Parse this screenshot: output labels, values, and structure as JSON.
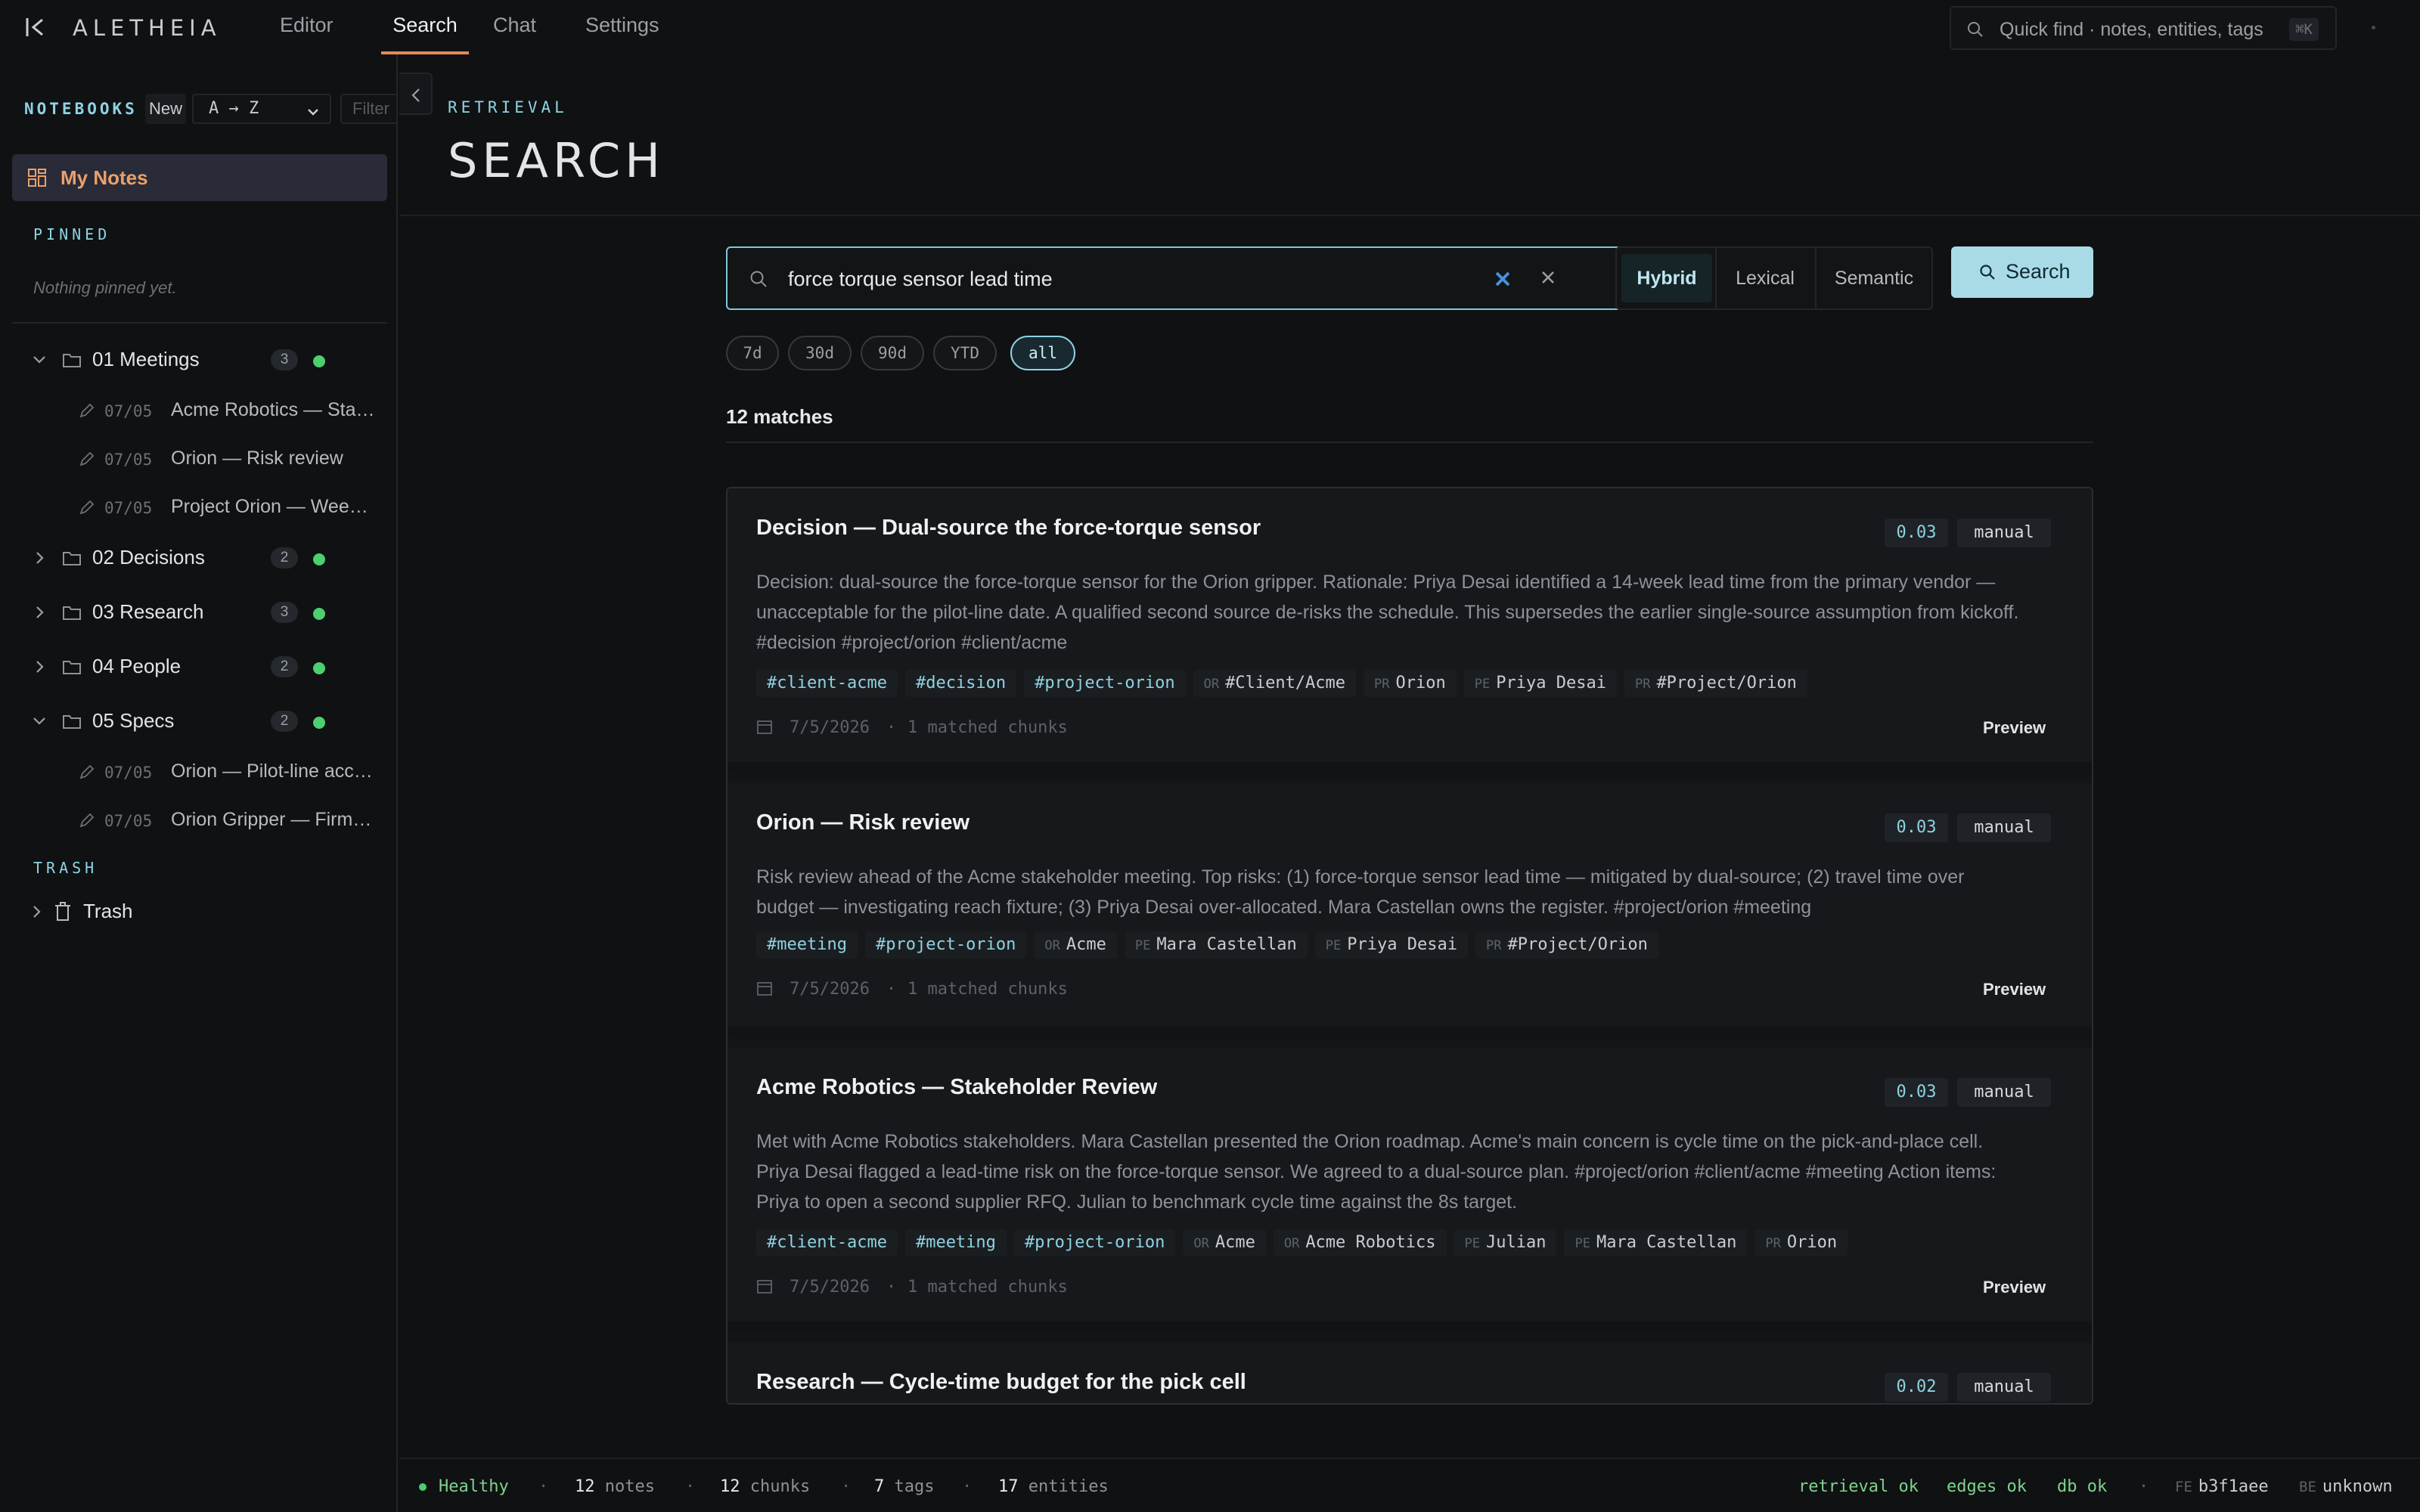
{
  "app": {
    "brand": "ALETHEIA",
    "tabs": [
      {
        "label": "Editor"
      },
      {
        "label": "Search"
      },
      {
        "label": "Chat"
      },
      {
        "label": "Settings"
      }
    ],
    "active_tab": "Search",
    "quick_find": {
      "placeholder": "Quick find · notes, entities, tags",
      "shortcut": "⌘K"
    }
  },
  "sidebar": {
    "title": "NOTEBOOKS",
    "new_label": "New",
    "sort_value": "A → Z",
    "filter_placeholder": "Filter",
    "my_notes": "My Notes",
    "pinned_label": "PINNED",
    "pinned_empty": "Nothing pinned yet.",
    "folders": [
      {
        "name": "01 Meetings",
        "count": "3",
        "expanded": true,
        "notes": [
          {
            "date": "07/05",
            "title": "Acme Robotics — Stakeholder Review"
          },
          {
            "date": "07/05",
            "title": "Orion — Risk review"
          },
          {
            "date": "07/05",
            "title": "Project Orion — Weekly sync"
          }
        ]
      },
      {
        "name": "02 Decisions",
        "count": "2",
        "expanded": false,
        "notes": []
      },
      {
        "name": "03 Research",
        "count": "3",
        "expanded": false,
        "notes": []
      },
      {
        "name": "04 People",
        "count": "2",
        "expanded": false,
        "notes": []
      },
      {
        "name": "05 Specs",
        "count": "2",
        "expanded": true,
        "notes": [
          {
            "date": "07/05",
            "title": "Orion — Pilot-line acceptance"
          },
          {
            "date": "07/05",
            "title": "Orion Gripper — Firmware spec"
          }
        ]
      }
    ],
    "trash_label": "TRASH",
    "trash_item": "Trash"
  },
  "main": {
    "eyebrow": "RETRIEVAL",
    "title": "SEARCH",
    "query": "force torque sensor lead time",
    "modes": [
      "Hybrid",
      "Lexical",
      "Semantic"
    ],
    "active_mode": "Hybrid",
    "search_button": "Search",
    "ranges": [
      "7d",
      "30d",
      "90d",
      "YTD",
      "all"
    ],
    "active_range": "all",
    "match_count": "12 matches",
    "results": [
      {
        "title": "Decision — Dual-source the force-torque sensor",
        "score": "0.03",
        "source": "manual",
        "snippet": "Decision: dual-source the force-torque sensor for the Orion gripper. Rationale: Priya Desai identified a 14-week lead time from the primary vendor — unacceptable for the pilot-line date. A qualified second source de-risks the schedule. This supersedes the earlier single-source assumption from kickoff. #decision #project/orion #client/acme",
        "tags": [
          "#client-acme",
          "#decision",
          "#project-orion"
        ],
        "entities": [
          {
            "type": "OR",
            "name": "#Client/Acme"
          },
          {
            "type": "PR",
            "name": "Orion"
          },
          {
            "type": "PE",
            "name": "Priya Desai"
          },
          {
            "type": "PR",
            "name": "#Project/Orion"
          }
        ],
        "date": "7/5/2026",
        "chunks": "1 matched chunks",
        "preview": "Preview"
      },
      {
        "title": "Orion — Risk review",
        "score": "0.03",
        "source": "manual",
        "snippet": "Risk review ahead of the Acme stakeholder meeting. Top risks: (1) force-torque sensor lead time — mitigated by dual-source; (2) travel time over budget — investigating reach fixture; (3) Priya Desai over-allocated. Mara Castellan owns the register. #project/orion #meeting",
        "tags": [
          "#meeting",
          "#project-orion"
        ],
        "entities": [
          {
            "type": "OR",
            "name": "Acme"
          },
          {
            "type": "PE",
            "name": "Mara Castellan"
          },
          {
            "type": "PE",
            "name": "Priya Desai"
          },
          {
            "type": "PR",
            "name": "#Project/Orion"
          }
        ],
        "date": "7/5/2026",
        "chunks": "1 matched chunks",
        "preview": "Preview"
      },
      {
        "title": "Acme Robotics — Stakeholder Review",
        "score": "0.03",
        "source": "manual",
        "snippet": "Met with Acme Robotics stakeholders. Mara Castellan presented the Orion roadmap. Acme's main concern is cycle time on the pick-and-place cell. Priya Desai flagged a lead-time risk on the force-torque sensor. We agreed to a dual-source plan. #project/orion #client/acme #meeting Action items: Priya to open a second supplier RFQ. Julian to benchmark cycle time against the 8s target.",
        "tags": [
          "#client-acme",
          "#meeting",
          "#project-orion"
        ],
        "entities": [
          {
            "type": "OR",
            "name": "Acme"
          },
          {
            "type": "OR",
            "name": "Acme Robotics"
          },
          {
            "type": "PE",
            "name": "Julian"
          },
          {
            "type": "PE",
            "name": "Mara Castellan"
          },
          {
            "type": "PR",
            "name": "Orion"
          }
        ],
        "date": "7/5/2026",
        "chunks": "1 matched chunks",
        "preview": "Preview"
      },
      {
        "title": "Research — Cycle-time budget for the pick cell",
        "score": "0.02",
        "source": "manual"
      }
    ]
  },
  "status": {
    "health": "Healthy",
    "notes_n": "12",
    "notes_l": "notes",
    "chunks_n": "12",
    "chunks_l": "chunks",
    "tags_n": "7",
    "tags_l": "tags",
    "entities_n": "17",
    "entities_l": "entities",
    "retrieval": "retrieval ok",
    "edges": "edges ok",
    "db": "db ok",
    "fe_label": "FE",
    "fe_value": "b3f1aee",
    "be_label": "BE",
    "be_value": "unknown"
  },
  "colors": {
    "accent": "#8fd3e2",
    "tab_underline": "#e58a55",
    "ok": "#4ccf6e",
    "my_notes": "#e9a06c"
  }
}
